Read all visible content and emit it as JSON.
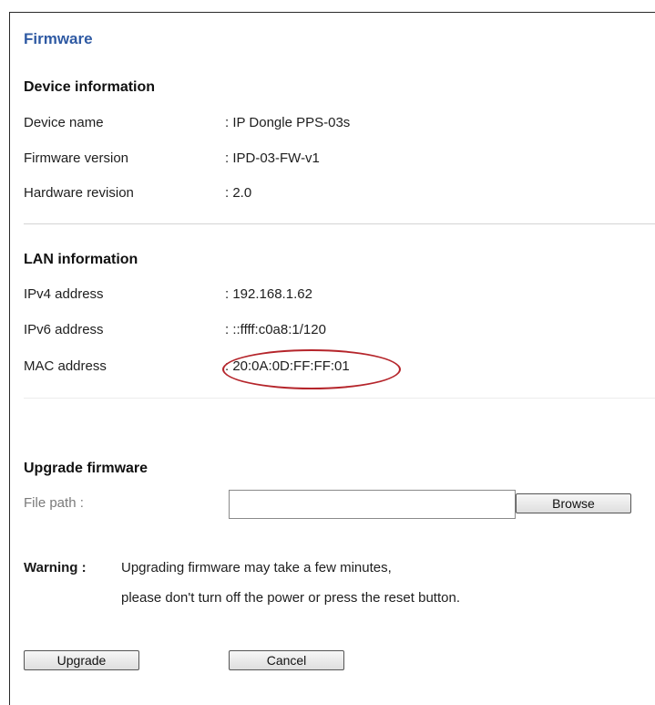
{
  "page": {
    "title": "Firmware"
  },
  "device_info": {
    "heading": "Device information",
    "rows": [
      {
        "label": "Device name",
        "value": ": IP Dongle PPS-03s"
      },
      {
        "label": "Firmware version",
        "value": ": IPD-03-FW-v1"
      },
      {
        "label": "Hardware revision",
        "value": ": 2.0"
      }
    ]
  },
  "lan_info": {
    "heading": "LAN information",
    "rows": [
      {
        "label": "IPv4 address",
        "value": ": 192.168.1.62"
      },
      {
        "label": "IPv6 address",
        "value": ": ::ffff:c0a8:1/120"
      },
      {
        "label": "MAC address",
        "value": ": 20:0A:0D:FF:FF:01"
      }
    ]
  },
  "upgrade": {
    "heading": "Upgrade firmware",
    "file_path_label": "File path :",
    "file_path_value": "",
    "browse_label": "Browse",
    "warning_label": "Warning :",
    "warning_line1": "Upgrading firmware may take a few minutes,",
    "warning_line2": "please don't turn off the power or press the reset button.",
    "upgrade_label": "Upgrade",
    "cancel_label": "Cancel"
  },
  "colors": {
    "title": "#2f5aa3",
    "highlight_ellipse": "#b5252b"
  }
}
